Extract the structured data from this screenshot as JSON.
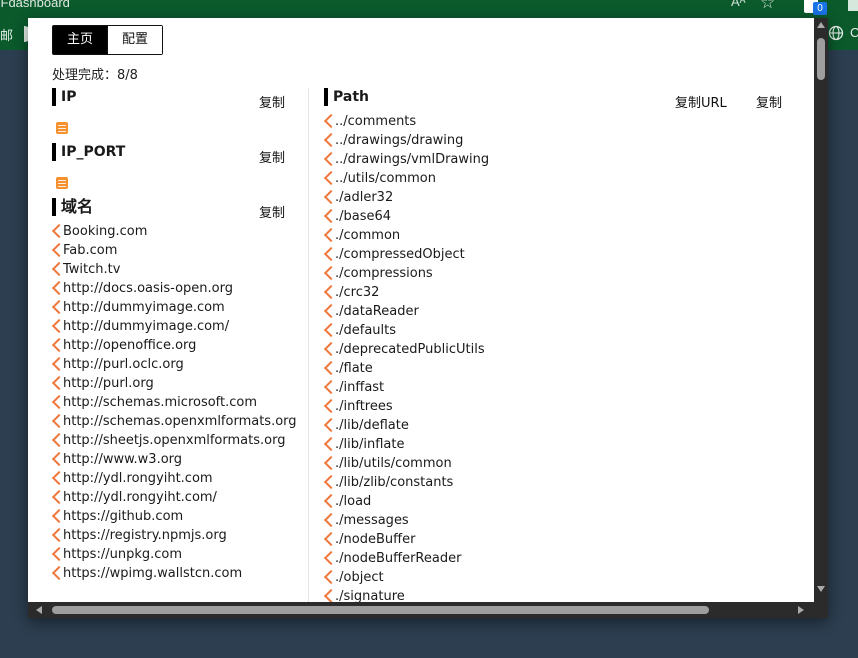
{
  "browser": {
    "title": "zFdashboard",
    "reader_label": "Aᴬ",
    "extension_badge": "0",
    "bookmark_left": "邮",
    "bookmark_right": "C"
  },
  "tabs": [
    {
      "label": "主页",
      "active": true
    },
    {
      "label": "配置",
      "active": false
    }
  ],
  "status": "处理完成：8/8",
  "left": {
    "ip": {
      "title": "IP",
      "copy_label": "复制"
    },
    "ip_port": {
      "title": "IP_PORT",
      "copy_label": "复制"
    },
    "domain": {
      "title": "域名",
      "copy_label": "复制",
      "items": [
        "Booking.com",
        "Fab.com",
        "Twitch.tv",
        "http://docs.oasis-open.org",
        "http://dummyimage.com",
        "http://dummyimage.com/",
        "http://openoffice.org",
        "http://purl.oclc.org",
        "http://purl.org",
        "http://schemas.microsoft.com",
        "http://schemas.openxmlformats.org",
        "http://sheetjs.openxmlformats.org",
        "http://www.w3.org",
        "http://ydl.rongyiht.com",
        "http://ydl.rongyiht.com/",
        "https://github.com",
        "https://registry.npmjs.org",
        "https://unpkg.com",
        "https://wpimg.wallstcn.com"
      ]
    }
  },
  "right": {
    "path": {
      "title": "Path",
      "copy_url_label": "复制URL",
      "copy_label": "复制",
      "items": [
        "../comments",
        "../drawings/drawing",
        "../drawings/vmlDrawing",
        "../utils/common",
        "./adler32",
        "./base64",
        "./common",
        "./compressedObject",
        "./compressions",
        "./crc32",
        "./dataReader",
        "./defaults",
        "./deprecatedPublicUtils",
        "./flate",
        "./inffast",
        "./inftrees",
        "./lib/deflate",
        "./lib/inflate",
        "./lib/utils/common",
        "./lib/zlib/constants",
        "./load",
        "./messages",
        "./nodeBuffer",
        "./nodeBufferReader",
        "./object",
        "./signature"
      ]
    }
  },
  "colors": {
    "accent_arrow": "#f0783c",
    "rss_icon": "#f7902f",
    "chrome_green": "#0a5a2c",
    "page_bg": "#2c3e50"
  }
}
